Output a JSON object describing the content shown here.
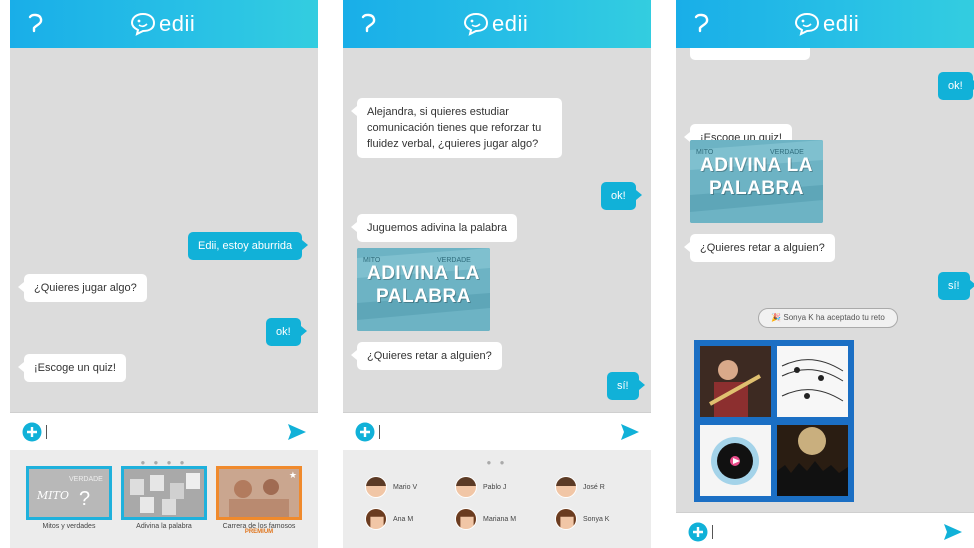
{
  "app": {
    "logo_text": "edii"
  },
  "screen1": {
    "messages": [
      {
        "dir": "out",
        "text": "Edii, estoy aburrida"
      },
      {
        "dir": "in",
        "text": "¿Quieres jugar algo?"
      },
      {
        "dir": "out",
        "text": "ok!"
      },
      {
        "dir": "in",
        "text": "¡Escoge un quiz!"
      }
    ],
    "quizzes": [
      {
        "label": "Mitos y verdades",
        "img_text": "MITO",
        "img_text2": "VERDADE"
      },
      {
        "label": "Adivina la palabra",
        "img_text": ""
      },
      {
        "label": "Carrera de los famosos",
        "badge": "PREMIUM",
        "img_text": ""
      }
    ]
  },
  "screen2": {
    "messages": [
      {
        "dir": "in",
        "text": "Alejandra, si quieres estudiar comunicación tienes que reforzar tu fluidez verbal, ¿quieres jugar algo?"
      },
      {
        "dir": "out",
        "text": "ok!"
      },
      {
        "dir": "in",
        "text": "Juguemos adivina la palabra"
      },
      {
        "dir": "in",
        "text": "¿Quieres retar a alguien?"
      },
      {
        "dir": "out",
        "text": "sí!"
      }
    ],
    "quiz_image_text": "ADIVINA LA PALABRA",
    "quiz_image_small": "MITO",
    "quiz_image_small2": "VERDADE",
    "friends": [
      {
        "name": "Mario V"
      },
      {
        "name": "Pablo J"
      },
      {
        "name": "José R"
      },
      {
        "name": "Ana M"
      },
      {
        "name": "Mariana M"
      },
      {
        "name": "Sonya K"
      }
    ]
  },
  "screen3": {
    "messages": [
      {
        "dir": "out",
        "text": "ok!"
      },
      {
        "dir": "in",
        "text": "¡Escoge un quiz!"
      },
      {
        "dir": "in",
        "text": "¿Quieres retar a alguien?"
      },
      {
        "dir": "out",
        "text": "sí!"
      }
    ],
    "quiz_image_text": "ADIVINA LA PALABRA",
    "quiz_image_small": "MITO",
    "quiz_image_small2": "VERDADE",
    "notice": "Sonya K ha aceptado tu reto"
  },
  "colors": {
    "accent": "#11b1d8",
    "header": "#19aee8",
    "premium": "#f08a2c",
    "grid": "#1b6fc4"
  }
}
